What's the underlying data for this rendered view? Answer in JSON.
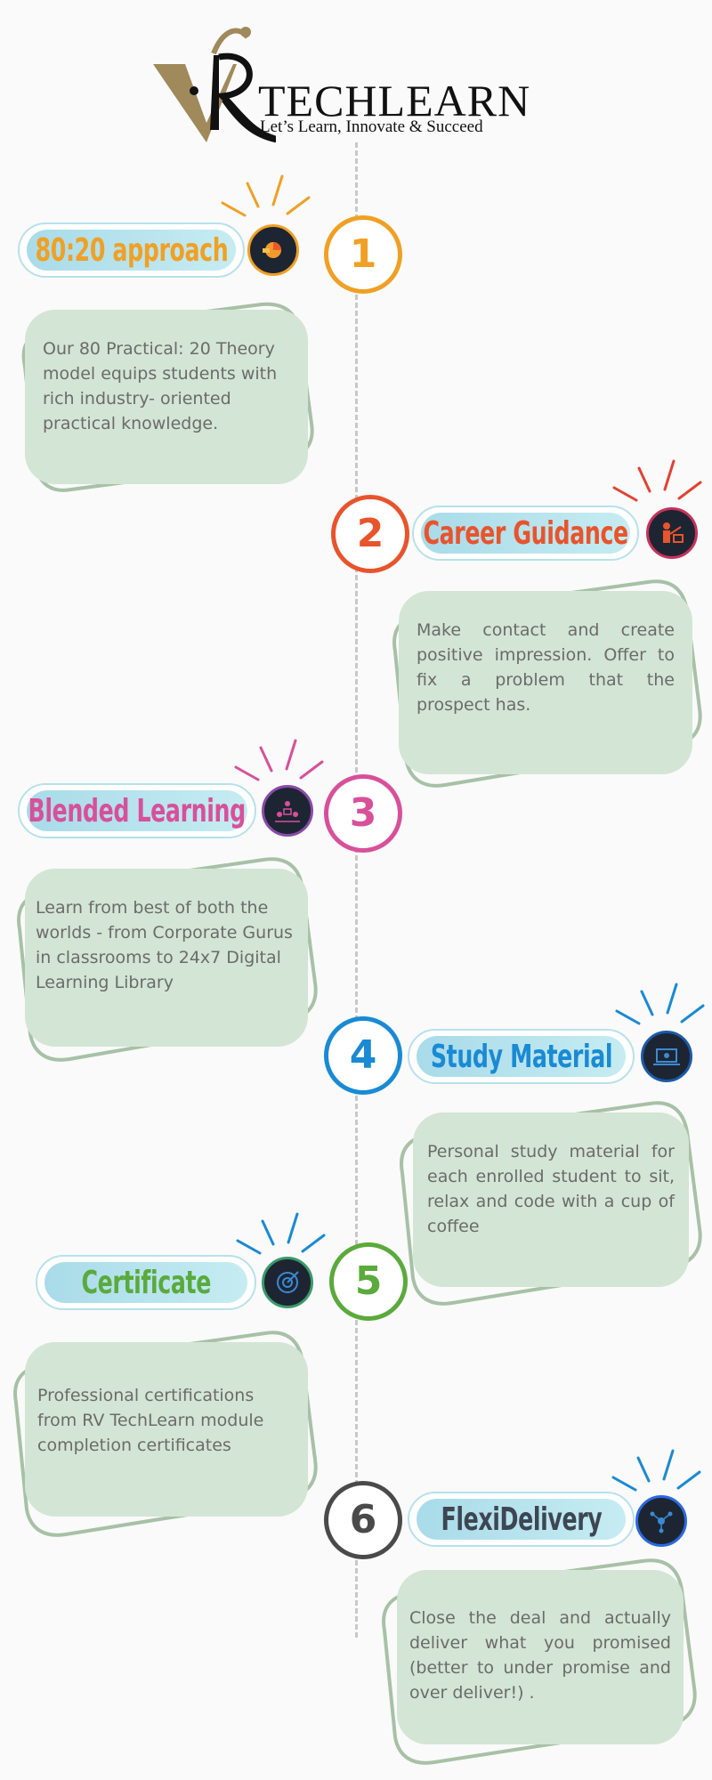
{
  "logo": {
    "title": "TECHLEARN",
    "tagline": "Let’s Learn, Innovate & Succeed",
    "mark": "RV"
  },
  "steps": [
    {
      "number": "1",
      "title": "80:20 approach",
      "text": "Our 80 Practical: 20 Theory model equips students with rich industry- oriented practical knowledge.",
      "color": "#f0a024",
      "icon": "presentation-pie-icon"
    },
    {
      "number": "2",
      "title": "Career Guidance",
      "text": "Make contact and create positive impression. Offer to fix a problem that the prospect has.",
      "color": "#e8542c",
      "icon": "teacher-board-icon"
    },
    {
      "number": "3",
      "title": "Blended Learning",
      "text": "Learn from best of both the worlds - from Corporate Gurus in classrooms to 24x7 Digital Learning Library",
      "color": "#d8509a",
      "icon": "group-learning-icon"
    },
    {
      "number": "4",
      "title": "Study Material",
      "text": "Personal study material for each enrolled student to sit, relax and code with a cup of coffee",
      "color": "#1a8ad4",
      "icon": "laptop-study-icon"
    },
    {
      "number": "5",
      "title": "Certificate",
      "text": "Professional certifications from RV TechLearn module completion certificates",
      "color": "#5aaa3c",
      "icon": "target-certificate-icon"
    },
    {
      "number": "6",
      "title": "FlexiDelivery",
      "text": "Close the deal and actually deliver what you promised (better to under promise and over deliver!) .",
      "color": "#4a4a4a",
      "icon": "network-delivery-icon"
    }
  ]
}
